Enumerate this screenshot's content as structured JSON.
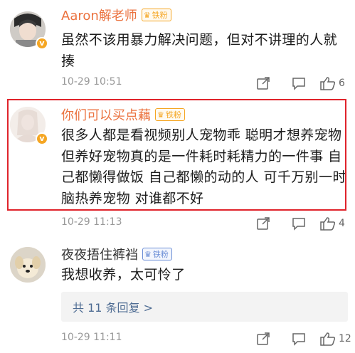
{
  "comments": [
    {
      "username": "Aaron解老师",
      "medal": "铁粉",
      "text": "虽然不该用暴力解决问题，但对不讲理的人就揍",
      "time": "10-29 10:51",
      "likes": "6"
    },
    {
      "username": "你们可以买点藕",
      "medal": "铁粉",
      "text": "很多人都是看视频别人宠物乖 聪明才想养宠物 但养好宠物真的是一件耗时耗精力的一件事 自己都懒得做饭 自己都懒的动的人 可千万别一时脑热养宠物 对谁都不好",
      "time": "10-29 11:13",
      "likes": "4"
    },
    {
      "username": "夜夜捂住裤裆",
      "medal": "铁粉",
      "text": "我想收养，太可怜了",
      "replies": "共 11 条回复 >",
      "time": "10-29 11:11",
      "likes": "12"
    }
  ],
  "colors": {
    "username": "#eb7340",
    "highlight_border": "#e0232b",
    "medal": "#f5a623",
    "reply_link": "#4e6c93"
  },
  "icons": [
    "share-icon",
    "comment-icon",
    "like-icon"
  ]
}
